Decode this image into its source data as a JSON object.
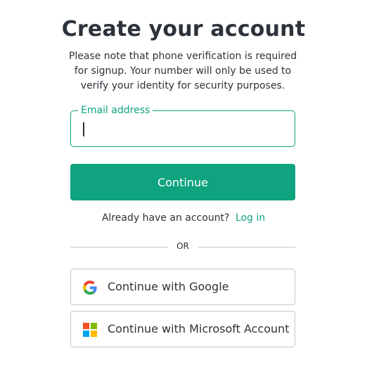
{
  "header": {
    "title": "Create your account",
    "subtitle": "Please note that phone verification is required for signup. Your number will only be used to verify your identity for security purposes."
  },
  "email": {
    "label": "Email address",
    "value": "",
    "placeholder": ""
  },
  "actions": {
    "continue_label": "Continue"
  },
  "login": {
    "prompt": "Already have an account?",
    "link_label": "Log in"
  },
  "divider": {
    "text": "OR"
  },
  "social": {
    "google_label": "Continue with Google",
    "google_icon": "google-icon",
    "microsoft_label": "Continue with Microsoft Account",
    "microsoft_icon": "microsoft-icon"
  },
  "colors": {
    "accent": "#10a37f",
    "text": "#2d333a",
    "border": "#c2c8d0",
    "google_blue": "#4285F4",
    "google_red": "#EA4335",
    "google_yellow": "#FBBC05",
    "google_green": "#34A853",
    "ms_red": "#F25022",
    "ms_green": "#7FBA00",
    "ms_blue": "#00A4EF",
    "ms_yellow": "#FFB900"
  }
}
